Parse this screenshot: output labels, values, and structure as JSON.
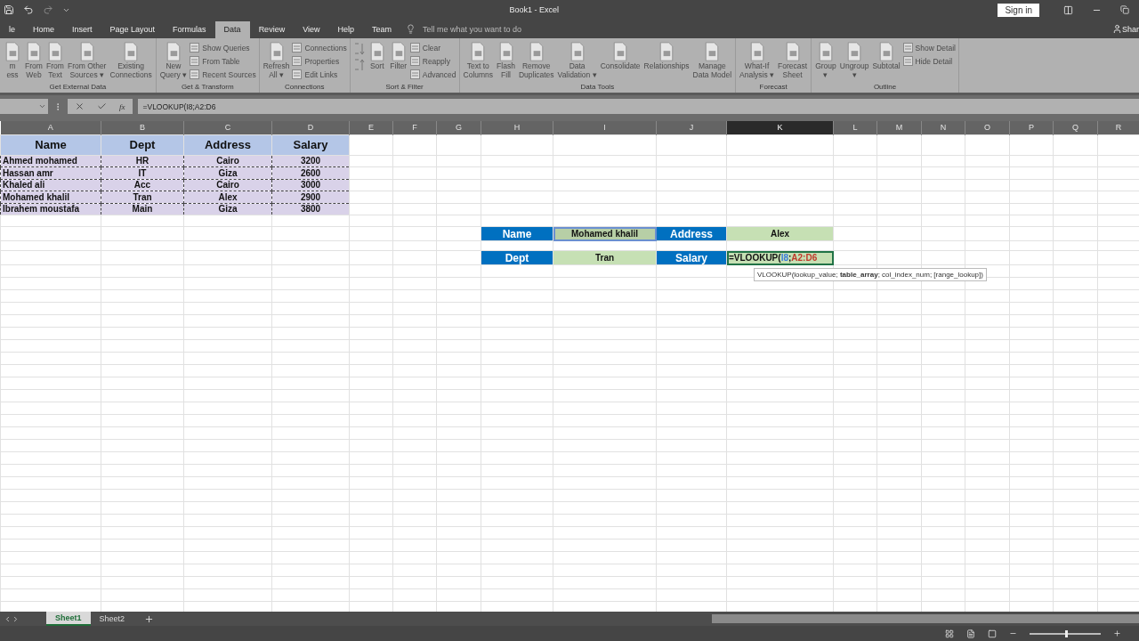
{
  "window": {
    "title": "Book1 - Excel",
    "sign_in": "Sign in",
    "share": "Shar"
  },
  "tabs": [
    {
      "label": "le",
      "selected": false
    },
    {
      "label": "Home",
      "selected": false
    },
    {
      "label": "Insert",
      "selected": false
    },
    {
      "label": "Page Layout",
      "selected": false
    },
    {
      "label": "Formulas",
      "selected": false
    },
    {
      "label": "Data",
      "selected": true
    },
    {
      "label": "Review",
      "selected": false
    },
    {
      "label": "View",
      "selected": false
    },
    {
      "label": "Help",
      "selected": false
    },
    {
      "label": "Team",
      "selected": false
    }
  ],
  "tell_me": {
    "placeholder": "Tell me what you want to do"
  },
  "ribbon": [
    {
      "label": "Get External Data",
      "buttons": [
        {
          "kind": "large",
          "lines": [
            "m",
            "ess"
          ]
        },
        {
          "kind": "large",
          "lines": [
            "From",
            "Web"
          ]
        },
        {
          "kind": "large",
          "lines": [
            "From",
            "Text"
          ]
        },
        {
          "kind": "large",
          "lines": [
            "From Other",
            "Sources ▾"
          ]
        },
        {
          "kind": "large",
          "lines": [
            "Existing",
            "Connections"
          ]
        }
      ]
    },
    {
      "label": "Get & Transform",
      "buttons": [
        {
          "kind": "large",
          "lines": [
            "New",
            "Query ▾"
          ]
        },
        {
          "kind": "stack",
          "items": [
            "Show Queries",
            "From Table",
            "Recent Sources"
          ]
        }
      ]
    },
    {
      "label": "Connections",
      "buttons": [
        {
          "kind": "large",
          "lines": [
            "Refresh",
            "All ▾"
          ]
        },
        {
          "kind": "stack",
          "items": [
            "Connections",
            "Properties",
            "Edit Links"
          ]
        }
      ]
    },
    {
      "label": "Sort & Filter",
      "buttons": [
        {
          "kind": "sortpair"
        },
        {
          "kind": "large",
          "lines": [
            "Sort"
          ]
        },
        {
          "kind": "large",
          "lines": [
            "Filter"
          ]
        },
        {
          "kind": "stack",
          "items": [
            "Clear",
            "Reapply",
            "Advanced"
          ]
        }
      ]
    },
    {
      "label": "Data Tools",
      "buttons": [
        {
          "kind": "large",
          "lines": [
            "Text to",
            "Columns"
          ]
        },
        {
          "kind": "large",
          "lines": [
            "Flash",
            "Fill"
          ]
        },
        {
          "kind": "large",
          "lines": [
            "Remove",
            "Duplicates"
          ]
        },
        {
          "kind": "large",
          "lines": [
            "Data",
            "Validation ▾"
          ]
        },
        {
          "kind": "large",
          "lines": [
            "Consolidate"
          ]
        },
        {
          "kind": "large",
          "lines": [
            "Relationships"
          ]
        },
        {
          "kind": "large",
          "lines": [
            "Manage",
            "Data Model"
          ]
        }
      ]
    },
    {
      "label": "Forecast",
      "buttons": [
        {
          "kind": "large",
          "lines": [
            "What-If",
            "Analysis ▾"
          ]
        },
        {
          "kind": "large",
          "lines": [
            "Forecast",
            "Sheet"
          ]
        }
      ]
    },
    {
      "label": "Outline",
      "buttons": [
        {
          "kind": "large",
          "lines": [
            "Group",
            "▾"
          ]
        },
        {
          "kind": "large",
          "lines": [
            "Ungroup",
            "▾"
          ]
        },
        {
          "kind": "large",
          "lines": [
            "Subtotal"
          ]
        },
        {
          "kind": "stack",
          "items": [
            "Show Detail",
            "Hide Detail"
          ]
        }
      ]
    }
  ],
  "formula_bar": {
    "function_label": "fx",
    "formula": "=VLOOKUP(I8;A2:D6"
  },
  "columns": [
    {
      "label": "A",
      "selected": false
    },
    {
      "label": "B",
      "selected": false
    },
    {
      "label": "C",
      "selected": false
    },
    {
      "label": "D",
      "selected": false
    },
    {
      "label": "E",
      "selected": false
    },
    {
      "label": "F",
      "selected": false
    },
    {
      "label": "G",
      "selected": false
    },
    {
      "label": "H",
      "selected": false
    },
    {
      "label": "I",
      "selected": false
    },
    {
      "label": "J",
      "selected": false
    },
    {
      "label": "K",
      "selected": true
    },
    {
      "label": "L",
      "selected": false
    },
    {
      "label": "M",
      "selected": false
    },
    {
      "label": "N",
      "selected": false
    },
    {
      "label": "O",
      "selected": false
    },
    {
      "label": "P",
      "selected": false
    },
    {
      "label": "Q",
      "selected": false
    },
    {
      "label": "R",
      "selected": false
    }
  ],
  "rows": [
    {
      "kind": "table-header",
      "cells": [
        {
          "text": "Name"
        },
        {
          "text": "Dept"
        },
        {
          "text": "Address"
        },
        {
          "text": "Salary"
        }
      ]
    },
    {
      "kind": "table",
      "cells": [
        {
          "text": "Ahmed mohamed"
        },
        {
          "text": "HR"
        },
        {
          "text": "Cairo"
        },
        {
          "text": "3200"
        }
      ]
    },
    {
      "kind": "table",
      "cells": [
        {
          "text": "Hassan amr"
        },
        {
          "text": "IT"
        },
        {
          "text": "Giza"
        },
        {
          "text": "2600"
        }
      ]
    },
    {
      "kind": "table",
      "cells": [
        {
          "text": "Khaled ali"
        },
        {
          "text": "Acc"
        },
        {
          "text": "Cairo"
        },
        {
          "text": "3000"
        }
      ]
    },
    {
      "kind": "table",
      "cells": [
        {
          "text": "Mohamed khalil"
        },
        {
          "text": "Tran"
        },
        {
          "text": "Alex"
        },
        {
          "text": "2900"
        }
      ]
    },
    {
      "kind": "table",
      "cells": [
        {
          "text": "Ibrahem moustafa"
        },
        {
          "text": "Main"
        },
        {
          "text": "Giza"
        },
        {
          "text": "3800"
        }
      ]
    },
    {
      "kind": "form",
      "cells": [
        {
          "kind": "label",
          "text": "Name"
        },
        {
          "kind": "value",
          "text": "Mohamed khalil",
          "highlighted": true
        },
        {
          "kind": "label",
          "text": "Address"
        },
        {
          "kind": "value",
          "text": "Alex",
          "highlighted": false
        }
      ]
    },
    {
      "kind": "form",
      "cells": [
        {
          "kind": "label",
          "text": "Dept"
        },
        {
          "kind": "value",
          "text": "Tran",
          "highlighted": false
        },
        {
          "kind": "label",
          "text": "Salary"
        },
        {
          "kind": "formula",
          "parts": [
            {
              "text": "=VLOOKUP("
            },
            {
              "text": "I8",
              "color": "#3b7ddd"
            },
            {
              "text": ";"
            },
            {
              "text": "A2:D6",
              "color": "#c0392b"
            }
          ],
          "tooltip": "VLOOKUP(lookup_value; **table_array**; col_index_num; [range_lookup])"
        }
      ]
    }
  ],
  "sheets": [
    {
      "label": "Sheet1",
      "selected": true
    },
    {
      "label": "Sheet2",
      "selected": false
    }
  ],
  "status_bar": {
    "zoom": {
      "level": 0.5
    }
  }
}
